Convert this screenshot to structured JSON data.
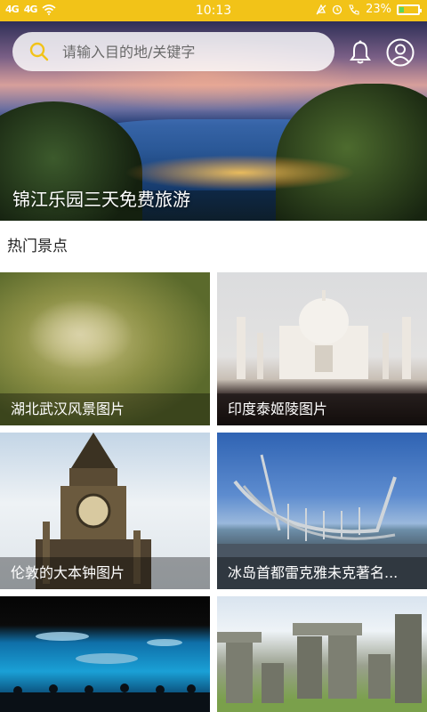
{
  "status_bar": {
    "signal_1": "4G",
    "signal_2": "4G",
    "time": "10:13",
    "battery_percent": "23%",
    "battery_level": 0.23
  },
  "search": {
    "placeholder": "请输入目的地/关键字"
  },
  "banner": {
    "caption": "锦江乐园三天免费旅游"
  },
  "section": {
    "title": "热门景点"
  },
  "attractions": [
    {
      "label": "湖北武汉风景图片"
    },
    {
      "label": "印度泰姬陵图片"
    },
    {
      "label": "伦敦的大本钟图片"
    },
    {
      "label": "冰岛首都雷克雅未克著名..."
    },
    {
      "label": ""
    },
    {
      "label": ""
    }
  ],
  "colors": {
    "status_bar": "#f2c318",
    "search_icon": "#f2c318",
    "tile_label_overlay": "rgba(0,0,0,0.35)"
  },
  "icons": {
    "search": "search-icon",
    "bell": "bell-icon",
    "avatar": "user-icon"
  }
}
